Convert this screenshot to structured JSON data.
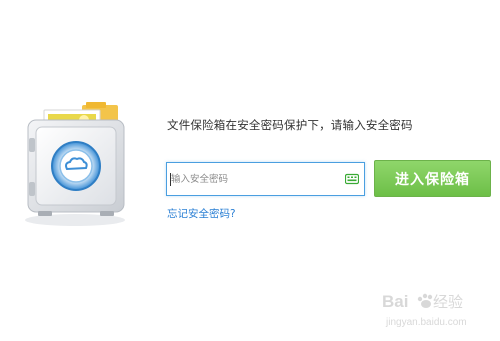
{
  "vault": {
    "prompt": "文件保险箱在安全密码保护下，请输入安全密码",
    "password_input": {
      "value": "",
      "placeholder": "输入安全密码"
    },
    "enter_button_label": "进入保险箱",
    "forgot_link": "忘记安全密码?"
  },
  "watermark": {
    "brand": "Baidu经验",
    "url": "jingyan.baidu.com"
  },
  "icons": {
    "safe": "safe-illustration-icon",
    "keyboard": "keyboard-icon"
  },
  "colors": {
    "accent_green": "#7ccb55",
    "input_border": "#4a9fe0",
    "link": "#2a7fd4",
    "keyboard_icon": "#3aaa35"
  }
}
